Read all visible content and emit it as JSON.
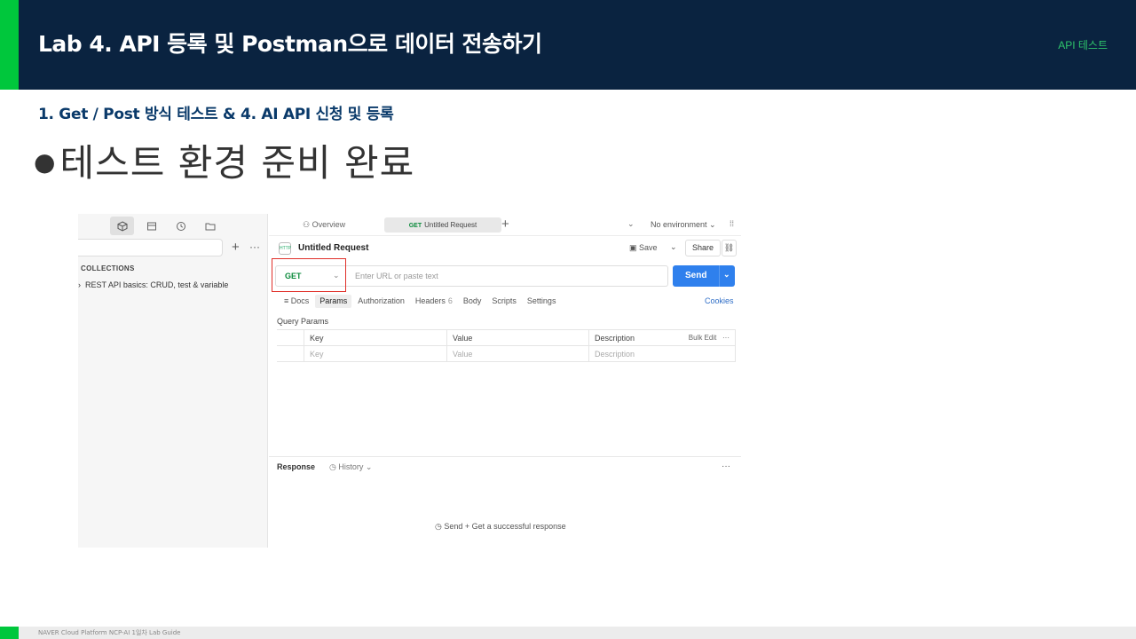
{
  "slide": {
    "title": "Lab 4. API 등록 및 Postman으로 데이터 전송하기",
    "tag": "API 테스트",
    "subtitle": "1. Get / Post 방식 테스트  &  4. AI API 신청 및 등록",
    "bullet": "테스트 환경 준비 완료",
    "footer": "NAVER Cloud Platform  NCP-AI 1일차 Lab Guide"
  },
  "postman": {
    "sidebar": {
      "icons": [
        "collections-icon",
        "environments-icon",
        "history-icon",
        "folder-icon"
      ],
      "collections_label": "COLLECTIONS",
      "collection_item": "REST API basics: CRUD, test & variable"
    },
    "tabs": {
      "overview": "Overview",
      "active_method": "GET",
      "active_label": "Untitled Request",
      "environment": "No environment"
    },
    "request": {
      "icon_text": "HTTP",
      "name": "Untitled Request",
      "save": "Save",
      "share": "Share",
      "method": "GET",
      "url_placeholder": "Enter URL or paste text",
      "send": "Send"
    },
    "request_tabs": {
      "docs": "Docs",
      "params": "Params",
      "authorization": "Authorization",
      "headers": "Headers",
      "headers_count": "6",
      "body": "Body",
      "scripts": "Scripts",
      "settings": "Settings",
      "cookies": "Cookies"
    },
    "query_params": {
      "title": "Query Params",
      "headers": [
        "Key",
        "Value",
        "Description"
      ],
      "bulk_edit": "Bulk Edit",
      "placeholders": [
        "Key",
        "Value",
        "Description"
      ]
    },
    "response": {
      "title": "Response",
      "history": "History",
      "empty": "Send + Get a successful response"
    }
  },
  "colors": {
    "header_bg": "#0a2340",
    "accent_green": "#00c73c",
    "send_blue": "#2f80ed",
    "method_green": "#0a8a3b",
    "highlight_red": "#e0302a"
  }
}
